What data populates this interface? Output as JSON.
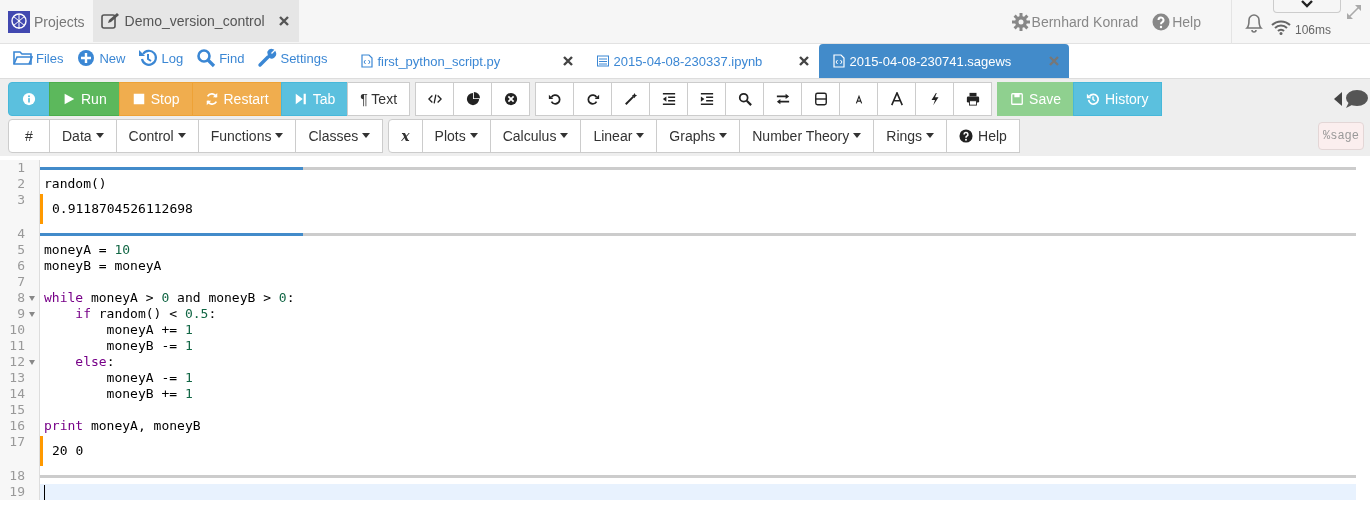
{
  "top_bar": {
    "projects": "Projects",
    "project_tab": {
      "title": "Demo_version_control",
      "selected": true
    },
    "user": "Bernhard Konrad",
    "help": "Help",
    "ping": "106ms"
  },
  "nav": [
    {
      "label": "Files"
    },
    {
      "label": "New"
    },
    {
      "label": "Log"
    },
    {
      "label": "Find"
    },
    {
      "label": "Settings"
    }
  ],
  "file_tabs": [
    {
      "label": "first_python_script.py",
      "selected": false
    },
    {
      "label": "2015-04-08-230337.ipynb",
      "selected": false
    },
    {
      "label": "2015-04-08-230741.sagews",
      "selected": true
    }
  ],
  "toolbar": [
    {
      "kind": "icon"
    },
    {
      "kind": "text",
      "label": "Run"
    },
    {
      "kind": "text",
      "label": "Stop"
    },
    {
      "kind": "text",
      "label": "Restart"
    },
    {
      "kind": "text",
      "label": "Tab"
    },
    {
      "kind": "text",
      "label": "¶ Text"
    },
    {
      "kind": "gap"
    },
    {
      "kind": "icon"
    },
    {
      "kind": "icon"
    },
    {
      "kind": "icon"
    },
    {
      "kind": "gap"
    },
    {
      "kind": "icon"
    },
    {
      "kind": "icon"
    },
    {
      "kind": "icon"
    },
    {
      "kind": "icon"
    },
    {
      "kind": "icon"
    },
    {
      "kind": "icon"
    },
    {
      "kind": "icon"
    },
    {
      "kind": "icon"
    },
    {
      "kind": "icon"
    },
    {
      "kind": "icon"
    },
    {
      "kind": "icon"
    },
    {
      "kind": "icon"
    },
    {
      "kind": "gap"
    },
    {
      "kind": "text",
      "label": "Save",
      "disabled": true
    },
    {
      "kind": "text",
      "label": "History",
      "disabled": false
    }
  ],
  "menus": [
    {
      "label": "#",
      "dropdown": false
    },
    {
      "label": "Data",
      "dropdown": true
    },
    {
      "label": "Control",
      "dropdown": true
    },
    {
      "label": "Functions",
      "dropdown": true
    },
    {
      "label": "Classes",
      "dropdown": true
    },
    {
      "label": "x",
      "dropdown": false,
      "gap": true
    },
    {
      "label": "Plots",
      "dropdown": true
    },
    {
      "label": "Calculus",
      "dropdown": true
    },
    {
      "label": "Linear",
      "dropdown": true
    },
    {
      "label": "Graphs",
      "dropdown": true
    },
    {
      "label": "Number Theory",
      "dropdown": true
    },
    {
      "label": "Rings",
      "dropdown": true
    },
    {
      "label": "Help",
      "dropdown": false
    }
  ],
  "mode_badge": "%sage",
  "editor": [
    {
      "n": "1",
      "kind": "divider",
      "level": 0.2
    },
    {
      "n": "2",
      "kind": "code",
      "tokens": [
        {
          "t": "random()",
          "kind": "plain"
        }
      ]
    },
    {
      "n": "3",
      "kind": "output",
      "text": "0.9118704526112698"
    },
    {
      "n": "4",
      "kind": "divider",
      "level": 0.2
    },
    {
      "n": "5",
      "kind": "code",
      "tokens": [
        {
          "t": "moneyA = ",
          "kind": "plain"
        },
        {
          "t": "10",
          "kind": "num"
        }
      ]
    },
    {
      "n": "6",
      "kind": "code",
      "tokens": [
        {
          "t": "moneyB = moneyA",
          "kind": "plain"
        }
      ]
    },
    {
      "n": "7",
      "kind": "blank"
    },
    {
      "n": "8",
      "kind": "code",
      "fold": true,
      "tokens": [
        {
          "t": "while",
          "kind": "kw"
        },
        {
          "t": " moneyA > ",
          "kind": "plain"
        },
        {
          "t": "0",
          "kind": "num"
        },
        {
          "t": " and moneyB > ",
          "kind": "plain"
        },
        {
          "t": "0",
          "kind": "num"
        },
        {
          "t": ":",
          "kind": "plain"
        }
      ]
    },
    {
      "n": "9",
      "kind": "code",
      "fold": true,
      "tokens": [
        {
          "t": "    if",
          "kind": "kw"
        },
        {
          "t": " random() < ",
          "kind": "plain"
        },
        {
          "t": "0.5",
          "kind": "num"
        },
        {
          "t": ":",
          "kind": "plain"
        }
      ]
    },
    {
      "n": "10",
      "kind": "code",
      "tokens": [
        {
          "t": "        moneyA += ",
          "kind": "plain"
        },
        {
          "t": "1",
          "kind": "num"
        }
      ]
    },
    {
      "n": "11",
      "kind": "code",
      "tokens": [
        {
          "t": "        moneyB -= ",
          "kind": "plain"
        },
        {
          "t": "1",
          "kind": "num"
        }
      ]
    },
    {
      "n": "12",
      "kind": "code",
      "fold": true,
      "tokens": [
        {
          "t": "    else",
          "kind": "kw"
        },
        {
          "t": ":",
          "kind": "plain"
        }
      ]
    },
    {
      "n": "13",
      "kind": "code",
      "tokens": [
        {
          "t": "        moneyA -= ",
          "kind": "plain"
        },
        {
          "t": "1",
          "kind": "num"
        }
      ]
    },
    {
      "n": "14",
      "kind": "code",
      "tokens": [
        {
          "t": "        moneyB += ",
          "kind": "plain"
        },
        {
          "t": "1",
          "kind": "num"
        }
      ]
    },
    {
      "n": "15",
      "kind": "blank"
    },
    {
      "n": "16",
      "kind": "code",
      "tokens": [
        {
          "t": "print",
          "kind": "kw"
        },
        {
          "t": " moneyA, moneyB",
          "kind": "plain"
        }
      ]
    },
    {
      "n": "17",
      "kind": "output",
      "text": "20 0"
    },
    {
      "n": "18",
      "kind": "divider"
    },
    {
      "n": "19",
      "kind": "cursor"
    }
  ]
}
